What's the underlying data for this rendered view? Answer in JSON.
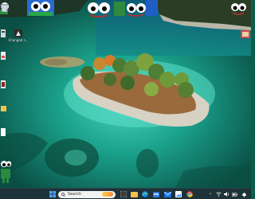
{
  "desktop": {
    "icons": [
      {
        "label": ""
      },
      {
        "label": "Changed s..."
      },
      {
        "label": ""
      }
    ]
  },
  "taskbar": {
    "search": {
      "placeholder": "Search"
    },
    "apps": [
      "start",
      "search",
      "widgets",
      "file-explorer",
      "edge",
      "store",
      "mail",
      "chrome"
    ],
    "tray": {
      "show_hidden_label": "^"
    }
  },
  "colors": {
    "water_deep": "#0e6a57",
    "water_shallow": "#2fb9a6",
    "taskbar_bg": "#203038",
    "accent_start": "#4aa3ff"
  }
}
